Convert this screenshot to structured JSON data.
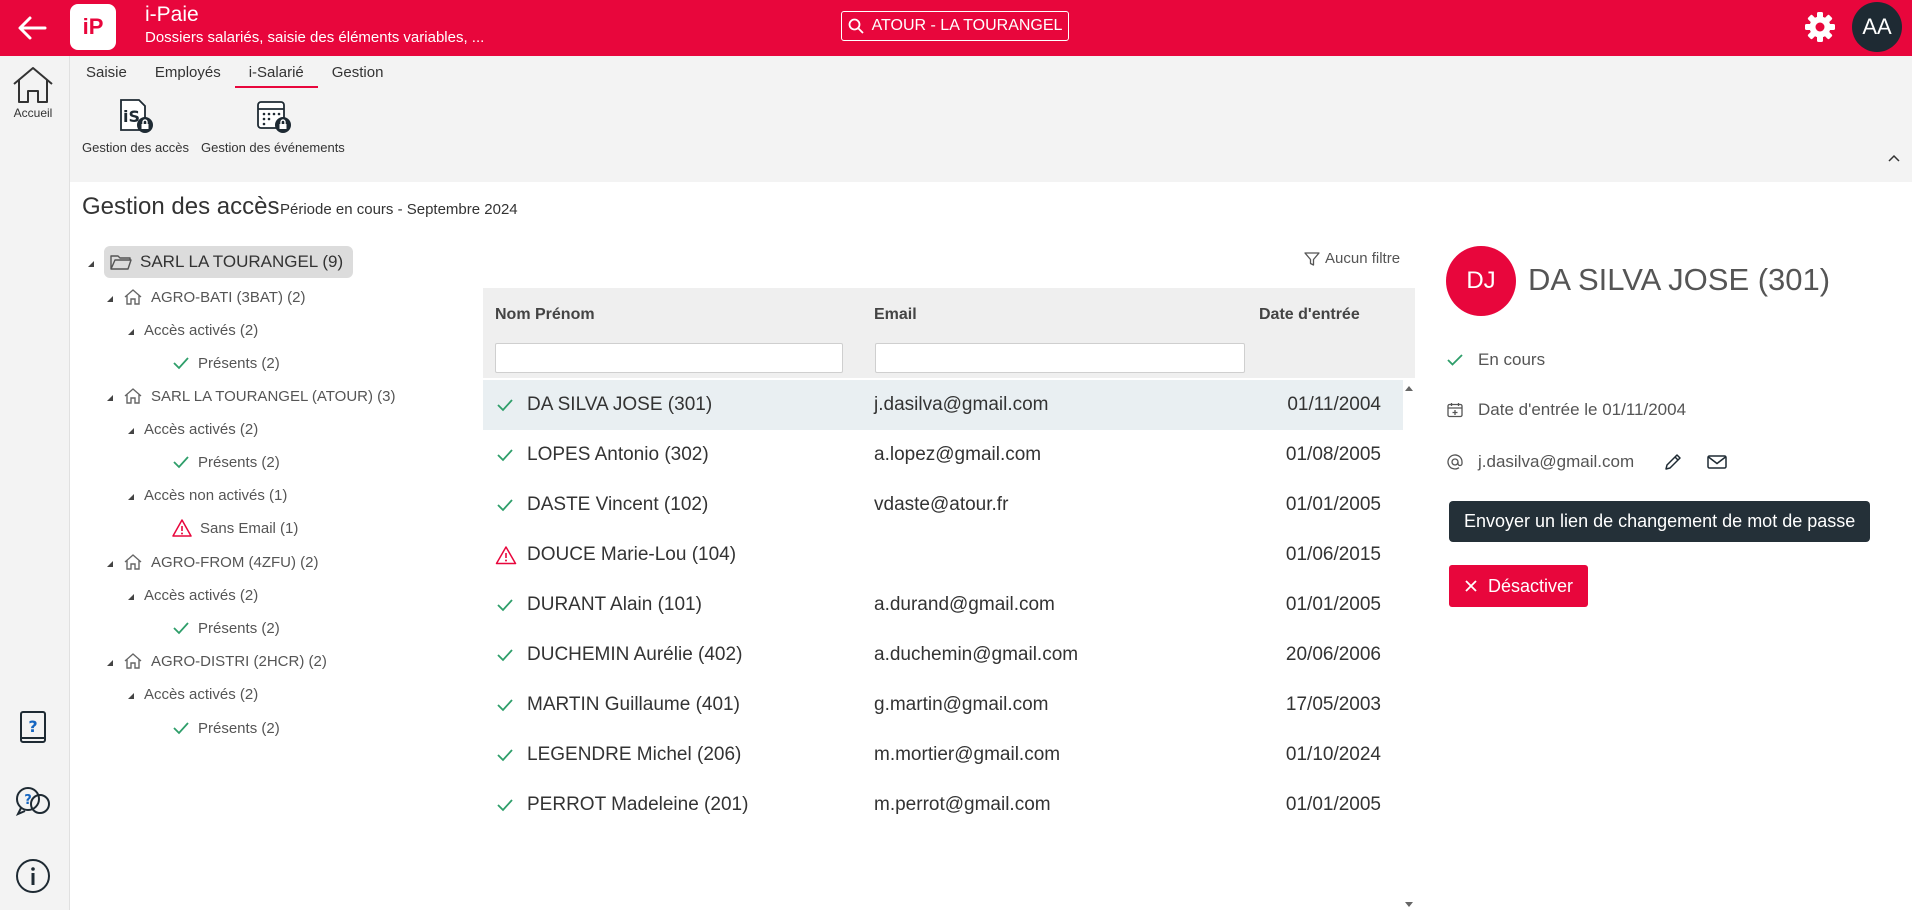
{
  "header": {
    "logo_text": "iP",
    "app_title": "i-Paie",
    "app_subtitle": "Dossiers salariés, saisie des éléments variables, ...",
    "company": "ATOUR - LA TOURANGEL",
    "user_initials": "AA",
    "brand_color": "#e8063c"
  },
  "leftrail": {
    "home_label": "Accueil",
    "icons": [
      "help-book-icon",
      "help-chat-icon",
      "info-icon"
    ]
  },
  "ribbon": {
    "tabs": [
      {
        "label": "Saisie",
        "active": false
      },
      {
        "label": "Employés",
        "active": false
      },
      {
        "label": "i-Salarié",
        "active": true
      },
      {
        "label": "Gestion",
        "active": false
      }
    ],
    "tools": [
      {
        "label": "Gestion des accès",
        "icon": "is-lock-icon"
      },
      {
        "label": "Gestion des événements",
        "icon": "calendar-lock-icon"
      }
    ]
  },
  "page": {
    "title": "Gestion des accès",
    "period": "Période en cours - Septembre 2024"
  },
  "tree": {
    "root": "SARL LA TOURANGEL (9)",
    "companies": [
      {
        "label": "AGRO-BATI (3BAT) (2)",
        "groups": [
          {
            "label": "Accès activés (2)",
            "items": [
              {
                "label": "Présents (2)",
                "status": "ok"
              }
            ]
          }
        ]
      },
      {
        "label": "SARL LA TOURANGEL (ATOUR) (3)",
        "groups": [
          {
            "label": "Accès activés (2)",
            "items": [
              {
                "label": "Présents (2)",
                "status": "ok"
              }
            ]
          },
          {
            "label": "Accès non activés (1)",
            "items": [
              {
                "label": "Sans Email (1)",
                "status": "warn"
              }
            ]
          }
        ]
      },
      {
        "label": "AGRO-FROM (4ZFU) (2)",
        "groups": [
          {
            "label": "Accès activés (2)",
            "items": [
              {
                "label": "Présents (2)",
                "status": "ok"
              }
            ]
          }
        ]
      },
      {
        "label": "AGRO-DISTRI (2HCR) (2)",
        "groups": [
          {
            "label": "Accès activés (2)",
            "items": [
              {
                "label": "Présents (2)",
                "status": "ok"
              }
            ]
          }
        ]
      }
    ]
  },
  "filter": {
    "label": "Aucun filtre"
  },
  "grid": {
    "columns": [
      "Nom Prénom",
      "Email",
      "Date d'entrée"
    ],
    "rows": [
      {
        "name": "DA SILVA JOSE (301)",
        "email": "j.dasilva@gmail.com",
        "date": "01/11/2004",
        "status": "ok",
        "selected": true
      },
      {
        "name": "LOPES Antonio (302)",
        "email": "a.lopez@gmail.com",
        "date": "01/08/2005",
        "status": "ok",
        "selected": false
      },
      {
        "name": "DASTE Vincent (102)",
        "email": "vdaste@atour.fr",
        "date": "01/01/2005",
        "status": "ok",
        "selected": false
      },
      {
        "name": "DOUCE Marie-Lou (104)",
        "email": "",
        "date": "01/06/2015",
        "status": "warn",
        "selected": false
      },
      {
        "name": "DURANT Alain (101)",
        "email": "a.durand@gmail.com",
        "date": "01/01/2005",
        "status": "ok",
        "selected": false
      },
      {
        "name": "DUCHEMIN Aurélie (402)",
        "email": "a.duchemin@gmail.com",
        "date": "20/06/2006",
        "status": "ok",
        "selected": false
      },
      {
        "name": "MARTIN Guillaume (401)",
        "email": "g.martin@gmail.com",
        "date": "17/05/2003",
        "status": "ok",
        "selected": false
      },
      {
        "name": "LEGENDRE Michel (206)",
        "email": "m.mortier@gmail.com",
        "date": "01/10/2024",
        "status": "ok",
        "selected": false
      },
      {
        "name": "PERROT Madeleine (201)",
        "email": "m.perrot@gmail.com",
        "date": "01/01/2005",
        "status": "ok",
        "selected": false
      }
    ]
  },
  "detail": {
    "initials": "DJ",
    "name": "DA SILVA JOSE (301)",
    "status": "En cours",
    "entry": "Date d'entrée le 01/11/2004",
    "email": "j.dasilva@gmail.com",
    "tooltip": "Envoyer un lien de changement de mot de passe",
    "deactivate_label": "Désactiver"
  },
  "colors": {
    "ok": "#2e9e6a",
    "warn": "#e8063c",
    "dark": "#243038"
  }
}
